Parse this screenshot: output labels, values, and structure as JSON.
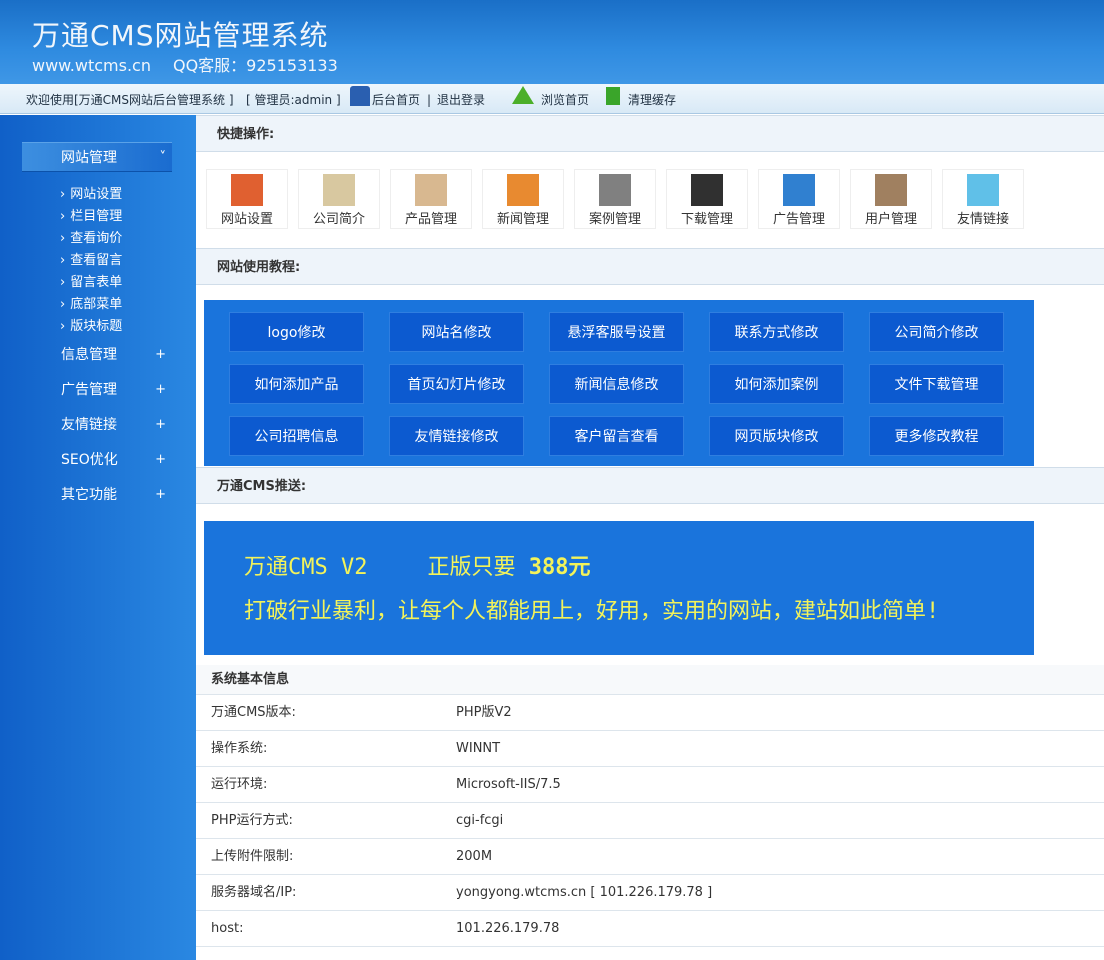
{
  "header": {
    "title": "万通CMS网站管理系统",
    "site": "www.wtcms.cn",
    "qq": "QQ客服：925153133"
  },
  "topbar": {
    "welcome": "欢迎使用[万通CMS网站后台管理系统 ]",
    "admin": "[ 管理员:admin ]",
    "home": "后台首页",
    "sep": "|",
    "logout": "退出登录",
    "browse": "浏览首页",
    "clear": "清理缓存"
  },
  "sidebar": {
    "groups": [
      {
        "label": "网站管理",
        "toggle": "˅"
      },
      {
        "label": "信息管理",
        "toggle": "+"
      },
      {
        "label": "广告管理",
        "toggle": "+"
      },
      {
        "label": "友情链接",
        "toggle": "+"
      },
      {
        "label": "SEO优化",
        "toggle": "+"
      },
      {
        "label": "其它功能",
        "toggle": "+"
      }
    ],
    "items": [
      "网站设置",
      "栏目管理",
      "查看询价",
      "查看留言",
      "留言表单",
      "底部菜单",
      "版块标题"
    ]
  },
  "quick": {
    "title": "快捷操作:",
    "items": [
      {
        "label": "网站设置",
        "color": "#e06030"
      },
      {
        "label": "公司简介",
        "color": "#d8c8a0"
      },
      {
        "label": "产品管理",
        "color": "#d8b890"
      },
      {
        "label": "新闻管理",
        "color": "#e88a30"
      },
      {
        "label": "案例管理",
        "color": "#808080"
      },
      {
        "label": "下载管理",
        "color": "#303030"
      },
      {
        "label": "广告管理",
        "color": "#3080d0"
      },
      {
        "label": "用户管理",
        "color": "#a08060"
      },
      {
        "label": "友情链接",
        "color": "#60c0e8"
      }
    ]
  },
  "tutorial": {
    "title": "网站使用教程:",
    "items": [
      "logo修改",
      "网站名修改",
      "悬浮客服号设置",
      "联系方式修改",
      "公司简介修改",
      "如何添加产品",
      "首页幻灯片修改",
      "新闻信息修改",
      "如何添加案例",
      "文件下载管理",
      "公司招聘信息",
      "友情链接修改",
      "客户留言查看",
      "网页版块修改",
      "更多修改教程"
    ]
  },
  "promo": {
    "title": "万通CMS推送:",
    "line1a": "万通CMS V2",
    "line1b": "正版只要",
    "price": "388元",
    "line2": "打破行业暴利，让每个人都能用上，好用，实用的网站，建站如此简单!"
  },
  "info": {
    "title": "系统基本信息",
    "rows": [
      [
        "万通CMS版本:",
        "PHP版V2"
      ],
      [
        "操作系统:",
        "WINNT"
      ],
      [
        "运行环境:",
        "Microsoft-IIS/7.5"
      ],
      [
        "PHP运行方式:",
        "cgi-fcgi"
      ],
      [
        "上传附件限制:",
        "200M"
      ],
      [
        "服务器域名/IP:",
        "yongyong.wtcms.cn [ 101.226.179.78 ]"
      ],
      [
        "host:",
        "101.226.179.78"
      ]
    ]
  }
}
